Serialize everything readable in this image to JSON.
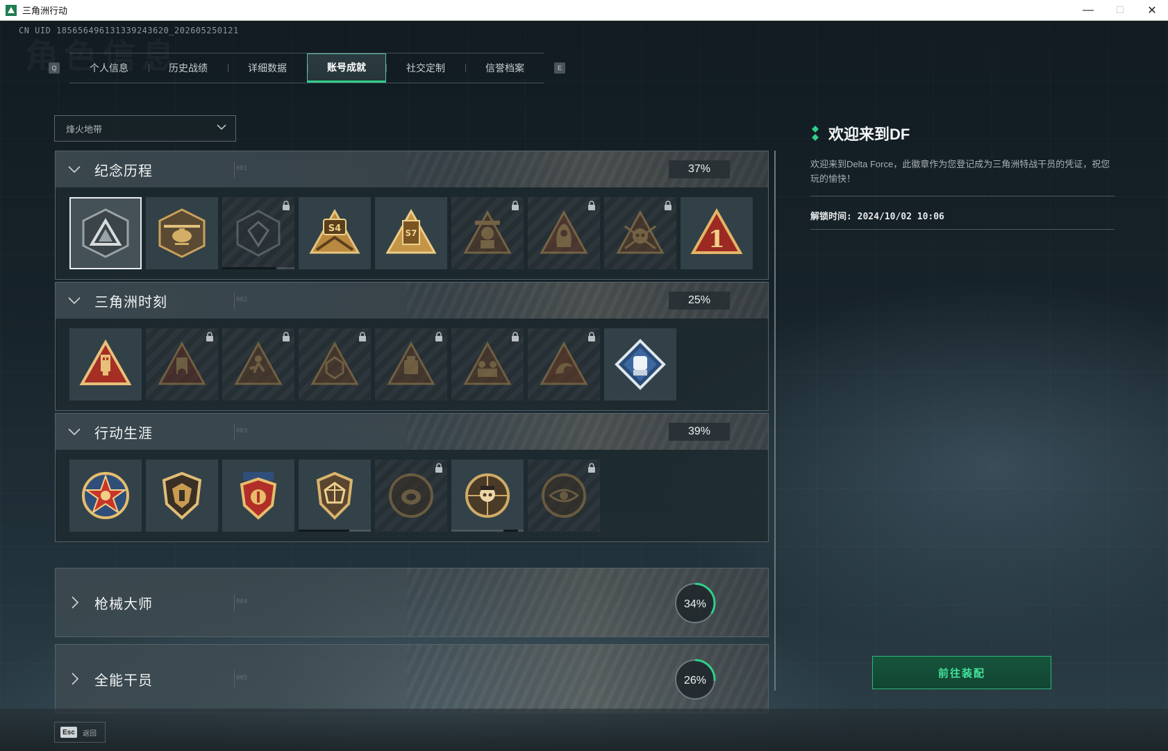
{
  "window": {
    "title": "三角洲行动",
    "minimize": "—",
    "maximize": "□",
    "close": "✕"
  },
  "uid": "CN UID 185656496131339243620_202605250121",
  "ghost_title": "角色信息",
  "tabs": {
    "left_key": "Q",
    "right_key": "E",
    "items": [
      {
        "label": "个人信息"
      },
      {
        "label": "历史战绩"
      },
      {
        "label": "详细数据"
      },
      {
        "label": "账号成就",
        "active": true
      },
      {
        "label": "社交定制"
      },
      {
        "label": "信誉档案"
      }
    ]
  },
  "dropdown": {
    "value": "烽火地带"
  },
  "sections": [
    {
      "name": "纪念历程",
      "code": "001",
      "percent": "37%",
      "expanded": true,
      "badges": [
        {
          "icon": "triangle-emblem-icon",
          "locked": false,
          "selected": true
        },
        {
          "icon": "helicopter-emblem-icon",
          "locked": false
        },
        {
          "icon": "hex-shield-emblem-icon",
          "locked": true,
          "progress": 0.75
        },
        {
          "icon": "s4-emblem-icon",
          "locked": false
        },
        {
          "icon": "s7-emblem-icon",
          "locked": false
        },
        {
          "icon": "soldier-emblem-icon",
          "locked": true
        },
        {
          "icon": "hooded-figure-emblem-icon",
          "locked": true
        },
        {
          "icon": "skull-swords-emblem-icon",
          "locked": true
        },
        {
          "icon": "number-one-emblem-icon",
          "locked": false
        }
      ]
    },
    {
      "name": "三角洲时刻",
      "code": "002",
      "percent": "25%",
      "expanded": true,
      "badges": [
        {
          "icon": "usb-triangle-emblem-icon",
          "locked": false
        },
        {
          "icon": "medal-triangle-emblem-icon",
          "locked": true
        },
        {
          "icon": "runner-triangle-emblem-icon",
          "locked": true
        },
        {
          "icon": "dice-triangle-emblem-icon",
          "locked": true
        },
        {
          "icon": "tactical-triangle-emblem-icon",
          "locked": true
        },
        {
          "icon": "squad-triangle-emblem-icon",
          "locked": true
        },
        {
          "icon": "dragon-triangle-emblem-icon",
          "locked": true
        },
        {
          "icon": "fist-diamond-emblem-icon",
          "locked": false
        }
      ]
    },
    {
      "name": "行动生涯",
      "code": "003",
      "percent": "39%",
      "expanded": true,
      "badges": [
        {
          "icon": "star-medal-icon",
          "locked": false
        },
        {
          "icon": "shield-wings-medal-icon",
          "locked": false
        },
        {
          "icon": "ribbon-medal-icon",
          "locked": false
        },
        {
          "icon": "geo-shield-medal-icon",
          "locked": false,
          "progress": 0.7
        },
        {
          "icon": "coin-medal-icon",
          "locked": true
        },
        {
          "icon": "skull-coin-medal-icon",
          "locked": false,
          "progress": 0.2
        },
        {
          "icon": "eye-coin-medal-icon",
          "locked": true
        }
      ]
    },
    {
      "name": "枪械大师",
      "code": "004",
      "percent": "34%",
      "percent_value": 0.34,
      "expanded": false
    },
    {
      "name": "全能干员",
      "code": "005",
      "percent": "26%",
      "percent_value": 0.26,
      "expanded": false
    }
  ],
  "info": {
    "title": "欢迎来到DF",
    "description": "欢迎来到Delta Force，此徽章作为您登记成为三角洲特战干员的凭证，祝您玩的愉快！",
    "unlock_time": "解锁时间: 2024/10/02 10:06"
  },
  "equip_button": "前往装配",
  "footer": {
    "esc_key": "Esc",
    "back_label": "返回"
  },
  "colors": {
    "accent": "#2fd08a",
    "gold": "#c9a15a",
    "panel": "#1e2a30"
  }
}
